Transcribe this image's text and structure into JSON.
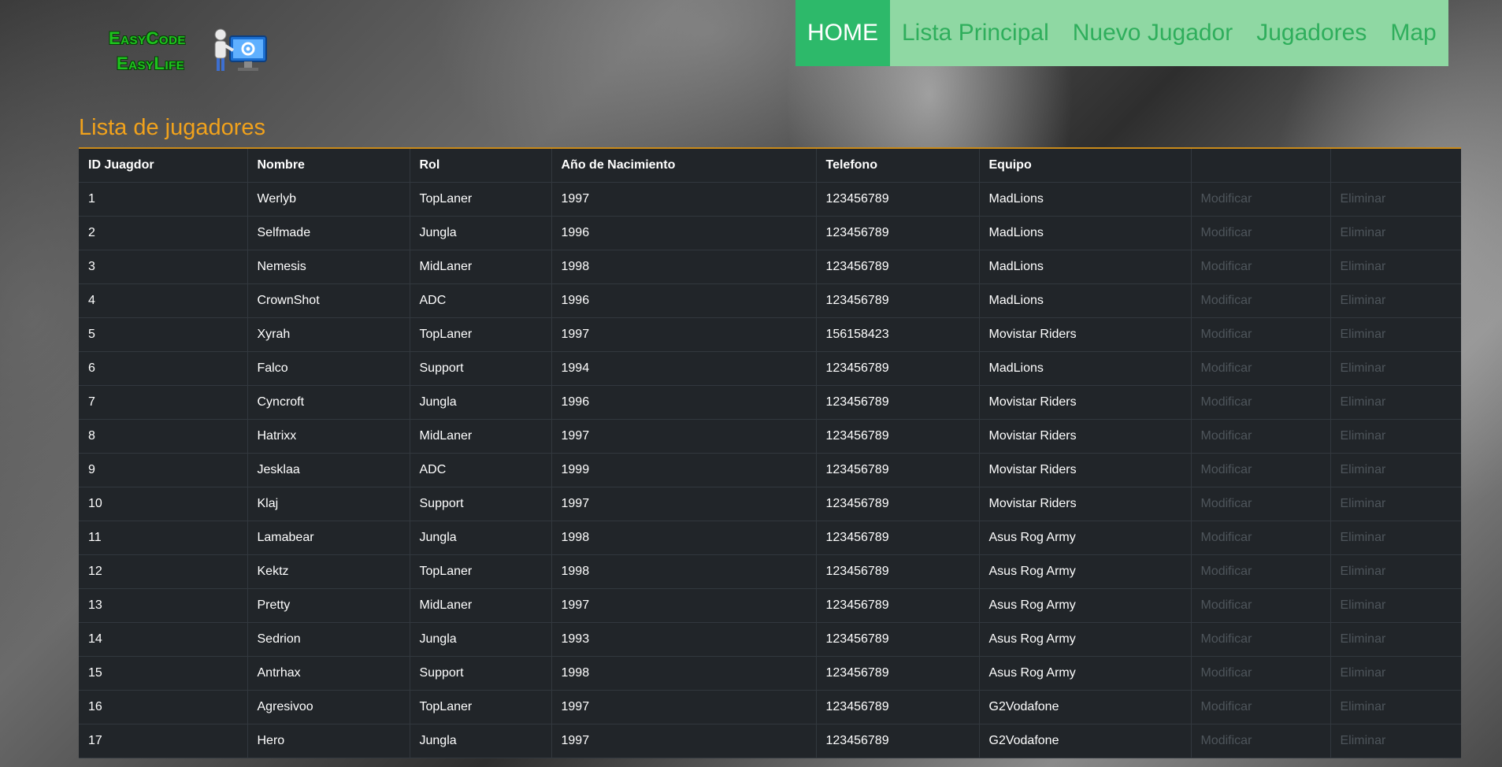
{
  "logo": {
    "line1": "EasyCode",
    "line2": "EasyLife"
  },
  "nav": {
    "items": [
      {
        "label": "HOME"
      },
      {
        "label": "Lista Principal"
      },
      {
        "label": "Nuevo Jugador"
      },
      {
        "label": "Jugadores"
      },
      {
        "label": "Map"
      }
    ]
  },
  "page": {
    "title": "Lista de jugadores"
  },
  "table": {
    "headers": [
      "ID Juagdor",
      "Nombre",
      "Rol",
      "Año de Nacimiento",
      "Telefono",
      "Equipo"
    ],
    "action_labels": {
      "modify": "Modificar",
      "delete": "Eliminar"
    },
    "rows": [
      [
        "1",
        "Werlyb",
        "TopLaner",
        "1997",
        "123456789",
        "MadLions"
      ],
      [
        "2",
        "Selfmade",
        "Jungla",
        "1996",
        "123456789",
        "MadLions"
      ],
      [
        "3",
        "Nemesis",
        "MidLaner",
        "1998",
        "123456789",
        "MadLions"
      ],
      [
        "4",
        "CrownShot",
        "ADC",
        "1996",
        "123456789",
        "MadLions"
      ],
      [
        "5",
        "Xyrah",
        "TopLaner",
        "1997",
        "156158423",
        "Movistar Riders"
      ],
      [
        "6",
        "Falco",
        "Support",
        "1994",
        "123456789",
        "MadLions"
      ],
      [
        "7",
        "Cyncroft",
        "Jungla",
        "1996",
        "123456789",
        "Movistar Riders"
      ],
      [
        "8",
        "Hatrixx",
        "MidLaner",
        "1997",
        "123456789",
        "Movistar Riders"
      ],
      [
        "9",
        "Jesklaa",
        "ADC",
        "1999",
        "123456789",
        "Movistar Riders"
      ],
      [
        "10",
        "Klaj",
        "Support",
        "1997",
        "123456789",
        "Movistar Riders"
      ],
      [
        "11",
        "Lamabear",
        "Jungla",
        "1998",
        "123456789",
        "Asus Rog Army"
      ],
      [
        "12",
        "Kektz",
        "TopLaner",
        "1998",
        "123456789",
        "Asus Rog Army"
      ],
      [
        "13",
        "Pretty",
        "MidLaner",
        "1997",
        "123456789",
        "Asus Rog Army"
      ],
      [
        "14",
        "Sedrion",
        "Jungla",
        "1993",
        "123456789",
        "Asus Rog Army"
      ],
      [
        "15",
        "Antrhax",
        "Support",
        "1998",
        "123456789",
        "Asus Rog Army"
      ],
      [
        "16",
        "Agresivoo",
        "TopLaner",
        "1997",
        "123456789",
        "G2Vodafone"
      ],
      [
        "17",
        "Hero",
        "Jungla",
        "1997",
        "123456789",
        "G2Vodafone"
      ]
    ]
  },
  "colors": {
    "nav_bg": "#8fd8a3",
    "nav_active": "#2db96a",
    "title": "#f1a21c",
    "table_bg": "#212529",
    "action_text": "#4e555b"
  }
}
